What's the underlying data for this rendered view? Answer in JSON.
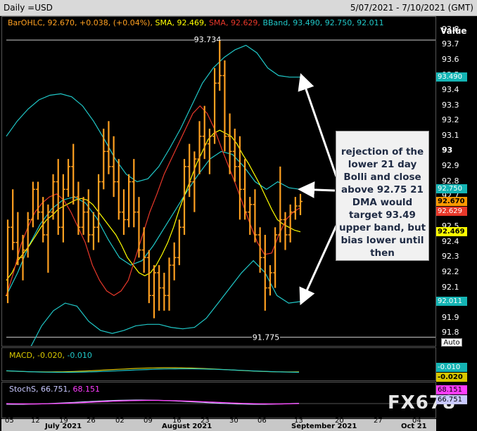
{
  "header": {
    "title": "Daily =USD",
    "date_range": "5/07/2021 - 7/10/2021 (GMT)"
  },
  "legend": {
    "bar": "BarOHLC, 92.670, +0.038, (+0.04%),",
    "sma1": "SMA, 92.469,",
    "sma2": "SMA, 92.629,",
    "bband": "BBand, 93.490, 92.750, 92.011"
  },
  "axis_title": "Value",
  "auto_label": "Auto",
  "colors": {
    "bars": "#ffa020",
    "sma_yellow": "#ffff00",
    "sma_red": "#e8382a",
    "bband": "#20c8c8",
    "macd": "#d8c800",
    "macd_signal": "#20c8c8",
    "stoch_k": "#c8c8ff",
    "stoch_d": "#ff3cff"
  },
  "price_ticks": [
    "93.8",
    "93.7",
    "93.6",
    "93.5",
    "93.4",
    "93.3",
    "93.2",
    "93.1",
    "93",
    "92.9",
    "92.8",
    "92.7",
    "92.6",
    "92.5",
    "92.4",
    "92.3",
    "92.2",
    "92.1",
    "92",
    "91.9",
    "91.8"
  ],
  "value_tags": [
    {
      "text": "93.490",
      "bg": "#14b4b4",
      "fg": "#ffffff"
    },
    {
      "text": "92.750",
      "bg": "#14b4b4",
      "fg": "#ffffff"
    },
    {
      "text": "92.670",
      "bg": "#ff9a00",
      "fg": "#000000"
    },
    {
      "text": "92.629",
      "bg": "#e8382a",
      "fg": "#ffffff"
    },
    {
      "text": "92.469",
      "bg": "#ffff00",
      "fg": "#000000"
    },
    {
      "text": "92.011",
      "bg": "#14b4b4",
      "fg": "#ffffff"
    }
  ],
  "hline_labels": {
    "high": "93.734",
    "low": "91.775"
  },
  "annotation": "rejection of the lower 21 day Bolli and close above 92.75 21 DMA would target 93.49 upper band, but bias lower until then",
  "macd": {
    "legend_name": "MACD,",
    "legend_v1": "-0.020,",
    "legend_v2": "-0.010",
    "tag1": "-0.010",
    "tag2": "-0.020"
  },
  "stoch": {
    "legend_name": "StochS,",
    "legend_v1": "66.751,",
    "legend_v2": "68.151",
    "tag1": "68.151",
    "tag2": "66.751"
  },
  "watermark": "FX678",
  "x_day_labels": [
    "05",
    "12",
    "19",
    "26",
    "02",
    "09",
    "16",
    "23",
    "30",
    "06",
    "13",
    "20",
    "27",
    "04"
  ],
  "x_month_labels": [
    "July 2021",
    "August 2021",
    "September 2021",
    "Oct 21"
  ],
  "chart_data": {
    "type": "bar",
    "title": "Daily =USD",
    "ylim": [
      91.75,
      93.85
    ],
    "bars_ohlc": [
      [
        92.05,
        92.55,
        92.0,
        92.5
      ],
      [
        92.5,
        92.75,
        92.35,
        92.4
      ],
      [
        92.4,
        92.6,
        92.25,
        92.3
      ],
      [
        92.3,
        92.45,
        92.15,
        92.35
      ],
      [
        92.35,
        92.6,
        92.3,
        92.55
      ],
      [
        92.55,
        92.8,
        92.5,
        92.75
      ],
      [
        92.75,
        92.8,
        92.55,
        92.6
      ],
      [
        92.6,
        92.7,
        92.4,
        92.45
      ],
      [
        92.45,
        92.65,
        92.2,
        92.6
      ],
      [
        92.6,
        92.85,
        92.55,
        92.8
      ],
      [
        92.8,
        92.95,
        92.45,
        92.5
      ],
      [
        92.5,
        92.85,
        92.4,
        92.75
      ],
      [
        92.75,
        92.95,
        92.7,
        92.9
      ],
      [
        92.9,
        93.05,
        92.65,
        92.7
      ],
      [
        92.7,
        92.8,
        92.45,
        92.5
      ],
      [
        92.5,
        92.7,
        92.45,
        92.6
      ],
      [
        92.6,
        92.75,
        92.4,
        92.45
      ],
      [
        92.45,
        92.6,
        92.35,
        92.5
      ],
      [
        92.5,
        92.85,
        92.4,
        92.8
      ],
      [
        92.8,
        93.15,
        92.75,
        93.0
      ],
      [
        93.0,
        93.2,
        92.85,
        92.9
      ],
      [
        92.9,
        93.1,
        92.7,
        92.8
      ],
      [
        92.8,
        92.95,
        92.55,
        92.6
      ],
      [
        92.6,
        92.75,
        92.45,
        92.55
      ],
      [
        92.55,
        92.85,
        92.5,
        92.8
      ],
      [
        92.8,
        92.95,
        92.5,
        92.6
      ],
      [
        92.6,
        92.7,
        92.3,
        92.35
      ],
      [
        92.35,
        92.5,
        92.2,
        92.3
      ],
      [
        92.3,
        92.35,
        92.0,
        92.05
      ],
      [
        92.05,
        92.25,
        91.9,
        92.2
      ],
      [
        92.2,
        92.25,
        91.95,
        92.1
      ],
      [
        92.1,
        92.2,
        91.95,
        92.05
      ],
      [
        92.05,
        92.3,
        91.95,
        92.25
      ],
      [
        92.25,
        92.4,
        92.15,
        92.3
      ],
      [
        92.3,
        92.55,
        92.25,
        92.5
      ],
      [
        92.5,
        92.95,
        92.45,
        92.9
      ],
      [
        92.9,
        93.05,
        92.7,
        92.8
      ],
      [
        92.8,
        93.0,
        92.6,
        92.95
      ],
      [
        92.95,
        93.2,
        92.85,
        93.1
      ],
      [
        93.1,
        93.3,
        92.95,
        93.05
      ],
      [
        93.05,
        93.15,
        92.85,
        93.1
      ],
      [
        93.1,
        93.55,
        93.05,
        93.45
      ],
      [
        93.45,
        93.73,
        93.4,
        93.5
      ],
      [
        93.5,
        93.6,
        93.0,
        93.1
      ],
      [
        93.1,
        93.25,
        92.85,
        93.0
      ],
      [
        93.0,
        93.15,
        92.8,
        92.9
      ],
      [
        92.9,
        93.1,
        92.55,
        92.75
      ],
      [
        92.75,
        92.95,
        92.55,
        92.6
      ],
      [
        92.6,
        92.7,
        92.45,
        92.65
      ],
      [
        92.65,
        92.75,
        92.4,
        92.45
      ],
      [
        92.45,
        92.5,
        92.2,
        92.3
      ],
      [
        92.3,
        92.45,
        91.95,
        92.1
      ],
      [
        92.1,
        92.25,
        92.05,
        92.2
      ],
      [
        92.2,
        92.5,
        92.1,
        92.45
      ],
      [
        92.45,
        92.9,
        92.4,
        92.55
      ],
      [
        92.55,
        92.6,
        92.35,
        92.45
      ],
      [
        92.45,
        92.65,
        92.4,
        92.6
      ],
      [
        92.6,
        92.7,
        92.55,
        92.64
      ],
      [
        92.64,
        92.72,
        92.58,
        92.67
      ]
    ],
    "sma_yellow": [
      92.15,
      92.2,
      92.28,
      92.33,
      92.38,
      92.44,
      92.5,
      92.55,
      92.58,
      92.62,
      92.64,
      92.66,
      92.68,
      92.69,
      92.68,
      92.65,
      92.6,
      92.55,
      92.5,
      92.45,
      92.38,
      92.3,
      92.25,
      92.2,
      92.18,
      92.2,
      92.25,
      92.32,
      92.4,
      92.5,
      92.62,
      92.72,
      92.82,
      92.92,
      93.0,
      93.08,
      93.12,
      93.14,
      93.12,
      93.1,
      93.05,
      92.98,
      92.92,
      92.85,
      92.78,
      92.7,
      92.62,
      92.55,
      92.52,
      92.5,
      92.48,
      92.47
    ],
    "sma_red": [
      92.05,
      92.2,
      92.38,
      92.5,
      92.6,
      92.66,
      92.7,
      92.72,
      92.68,
      92.6,
      92.5,
      92.4,
      92.25,
      92.15,
      92.08,
      92.05,
      92.08,
      92.15,
      92.3,
      92.45,
      92.6,
      92.72,
      92.85,
      92.95,
      93.05,
      93.15,
      93.25,
      93.3,
      93.25,
      93.15,
      93.02,
      92.9,
      92.78,
      92.65,
      92.52,
      92.4,
      92.32,
      92.33,
      92.45,
      92.55,
      92.6,
      92.63
    ],
    "bband_upper": [
      93.1,
      93.2,
      93.28,
      93.34,
      93.37,
      93.38,
      93.36,
      93.3,
      93.2,
      93.08,
      92.95,
      92.85,
      92.8,
      92.82,
      92.9,
      93.02,
      93.15,
      93.3,
      93.45,
      93.55,
      93.62,
      93.67,
      93.7,
      93.65,
      93.55,
      93.5,
      93.49,
      93.49
    ],
    "bband_middle": [
      92.05,
      92.2,
      92.38,
      92.52,
      92.62,
      92.68,
      92.7,
      92.66,
      92.56,
      92.42,
      92.3,
      92.25,
      92.28,
      92.38,
      92.5,
      92.62,
      92.74,
      92.85,
      92.95,
      93.0,
      92.98,
      92.9,
      92.8,
      92.75,
      92.8,
      92.76,
      92.75
    ],
    "bband_lower": [
      91.3,
      91.5,
      91.7,
      91.85,
      91.95,
      92.0,
      91.98,
      91.88,
      91.82,
      91.8,
      91.82,
      91.85,
      91.86,
      91.86,
      91.84,
      91.83,
      91.84,
      91.9,
      92.0,
      92.1,
      92.2,
      92.28,
      92.2,
      92.05,
      92.0,
      92.01
    ],
    "macd": {
      "name": "MACD",
      "values": [
        -0.02,
        -0.01
      ]
    },
    "stoch": {
      "name": "StochS",
      "values": [
        66.751,
        68.151
      ]
    }
  }
}
